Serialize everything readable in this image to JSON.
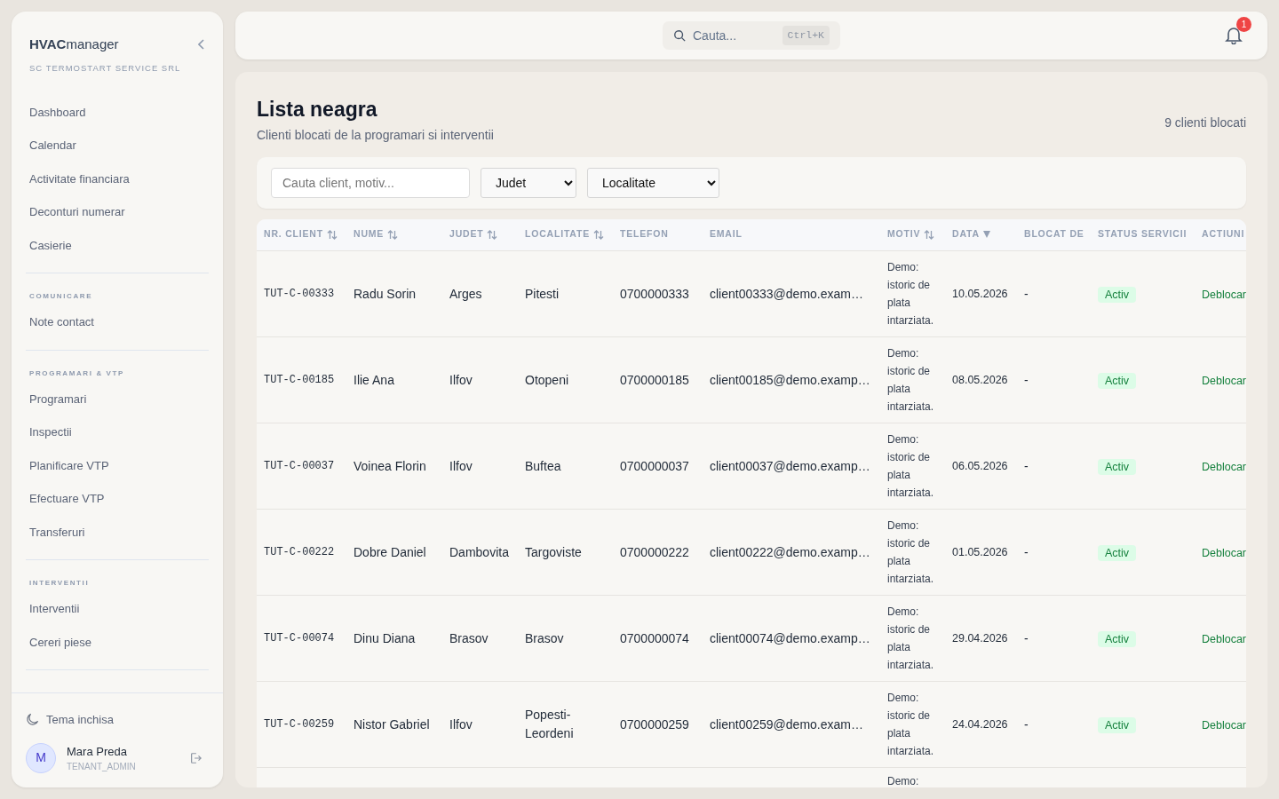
{
  "sidebar": {
    "brand": "**HVAC**manager",
    "company": "SC TERMOSTART SERVICE SRL",
    "sections": [
      {
        "items": [
          {
            "label": "Dashboard"
          },
          {
            "label": "Calendar"
          },
          {
            "label": "Activitate financiara"
          },
          {
            "label": "Deconturi numerar"
          },
          {
            "label": "Casierie"
          }
        ]
      },
      {
        "title": "COMUNICARE",
        "items": [
          {
            "label": "Note contact"
          }
        ]
      },
      {
        "title": "PROGRAMARI & VTP",
        "items": [
          {
            "label": "Programari"
          },
          {
            "label": "Inspectii"
          },
          {
            "label": "Planificare VTP"
          },
          {
            "label": "Efectuare VTP"
          },
          {
            "label": "Transferuri"
          }
        ]
      },
      {
        "title": "INTERVENTII",
        "items": [
          {
            "label": "Interventii"
          },
          {
            "label": "Cereri piese"
          }
        ]
      }
    ],
    "theme_toggle": "Tema inchisa",
    "user": {
      "initial": "M",
      "name": "Mara Preda",
      "role": "TENANT_ADMIN"
    }
  },
  "topbar": {
    "search": {
      "placeholder": "Cauta...",
      "shortcut": "Ctrl+K"
    },
    "notifications": "1"
  },
  "page": {
    "title": "Lista neagra",
    "subtitle": "Clienti blocati de la programari si interventii",
    "count": "9 clienti blocati"
  },
  "filters": {
    "search": {
      "placeholder": "Cauta client, motiv..."
    },
    "selects": [
      {
        "value": "Judet"
      },
      {
        "value": "Localitate"
      }
    ]
  },
  "table": {
    "columns": [
      {
        "label": "NR. CLIENT",
        "sortable": true,
        "sorted_desc": false
      },
      {
        "label": "NUME",
        "sortable": true,
        "sorted_desc": false
      },
      {
        "label": "JUDET",
        "sortable": true,
        "sorted_desc": false
      },
      {
        "label": "LOCALITATE",
        "sortable": true,
        "sorted_desc": false
      },
      {
        "label": "TELEFON",
        "sortable": false,
        "sorted_desc": false
      },
      {
        "label": "EMAIL",
        "sortable": false,
        "sorted_desc": false
      },
      {
        "label": "MOTIV",
        "sortable": true,
        "sorted_desc": false
      },
      {
        "label": "DATA",
        "sortable": false,
        "sorted_desc": true
      },
      {
        "label": "BLOCAT DE",
        "sortable": false,
        "sorted_desc": false
      },
      {
        "label": "STATUS SERVICII",
        "sortable": false,
        "sorted_desc": false
      },
      {
        "label": "ACTIUNI",
        "sortable": false,
        "sorted_desc": false
      }
    ],
    "rows": [
      {
        "nr": "TUT-C-00333",
        "nume": "Radu Sorin",
        "judet": "Arges",
        "localitate": "Pitesti",
        "telefon": "0700000333",
        "email": "client00333@demo.exam…",
        "motiv": "Demo: istoric de plata intarziata.",
        "data": "10.05.2026",
        "blocat_de": "-",
        "status": "Activ",
        "action": "Deblocar"
      },
      {
        "nr": "TUT-C-00185",
        "nume": "Ilie Ana",
        "judet": "Ilfov",
        "localitate": "Otopeni",
        "telefon": "0700000185",
        "email": "client00185@demo.examp…",
        "motiv": "Demo: istoric de plata intarziata.",
        "data": "08.05.2026",
        "blocat_de": "-",
        "status": "Activ",
        "action": "Deblocar"
      },
      {
        "nr": "TUT-C-00037",
        "nume": "Voinea Florin",
        "judet": "Ilfov",
        "localitate": "Buftea",
        "telefon": "0700000037",
        "email": "client00037@demo.examp…",
        "motiv": "Demo: istoric de plata intarziata.",
        "data": "06.05.2026",
        "blocat_de": "-",
        "status": "Activ",
        "action": "Deblocar"
      },
      {
        "nr": "TUT-C-00222",
        "nume": "Dobre Daniel",
        "judet": "Dambovita",
        "localitate": "Targoviste",
        "telefon": "0700000222",
        "email": "client00222@demo.examp…",
        "motiv": "Demo: istoric de plata intarziata.",
        "data": "01.05.2026",
        "blocat_de": "-",
        "status": "Activ",
        "action": "Deblocar"
      },
      {
        "nr": "TUT-C-00074",
        "nume": "Dinu Diana",
        "judet": "Brasov",
        "localitate": "Brasov",
        "telefon": "0700000074",
        "email": "client00074@demo.examp…",
        "motiv": "Demo: istoric de plata intarziata.",
        "data": "29.04.2026",
        "blocat_de": "-",
        "status": "Activ",
        "action": "Deblocar"
      },
      {
        "nr": "TUT-C-00259",
        "nume": "Nistor Gabriel",
        "judet": "Ilfov",
        "localitate": "Popesti-Leordeni",
        "telefon": "0700000259",
        "email": "client00259@demo.exam…",
        "motiv": "Demo: istoric de plata intarziata.",
        "data": "24.04.2026",
        "blocat_de": "-",
        "status": "Activ",
        "action": "Deblocar"
      },
      {
        "motiv": "Demo:"
      }
    ]
  }
}
